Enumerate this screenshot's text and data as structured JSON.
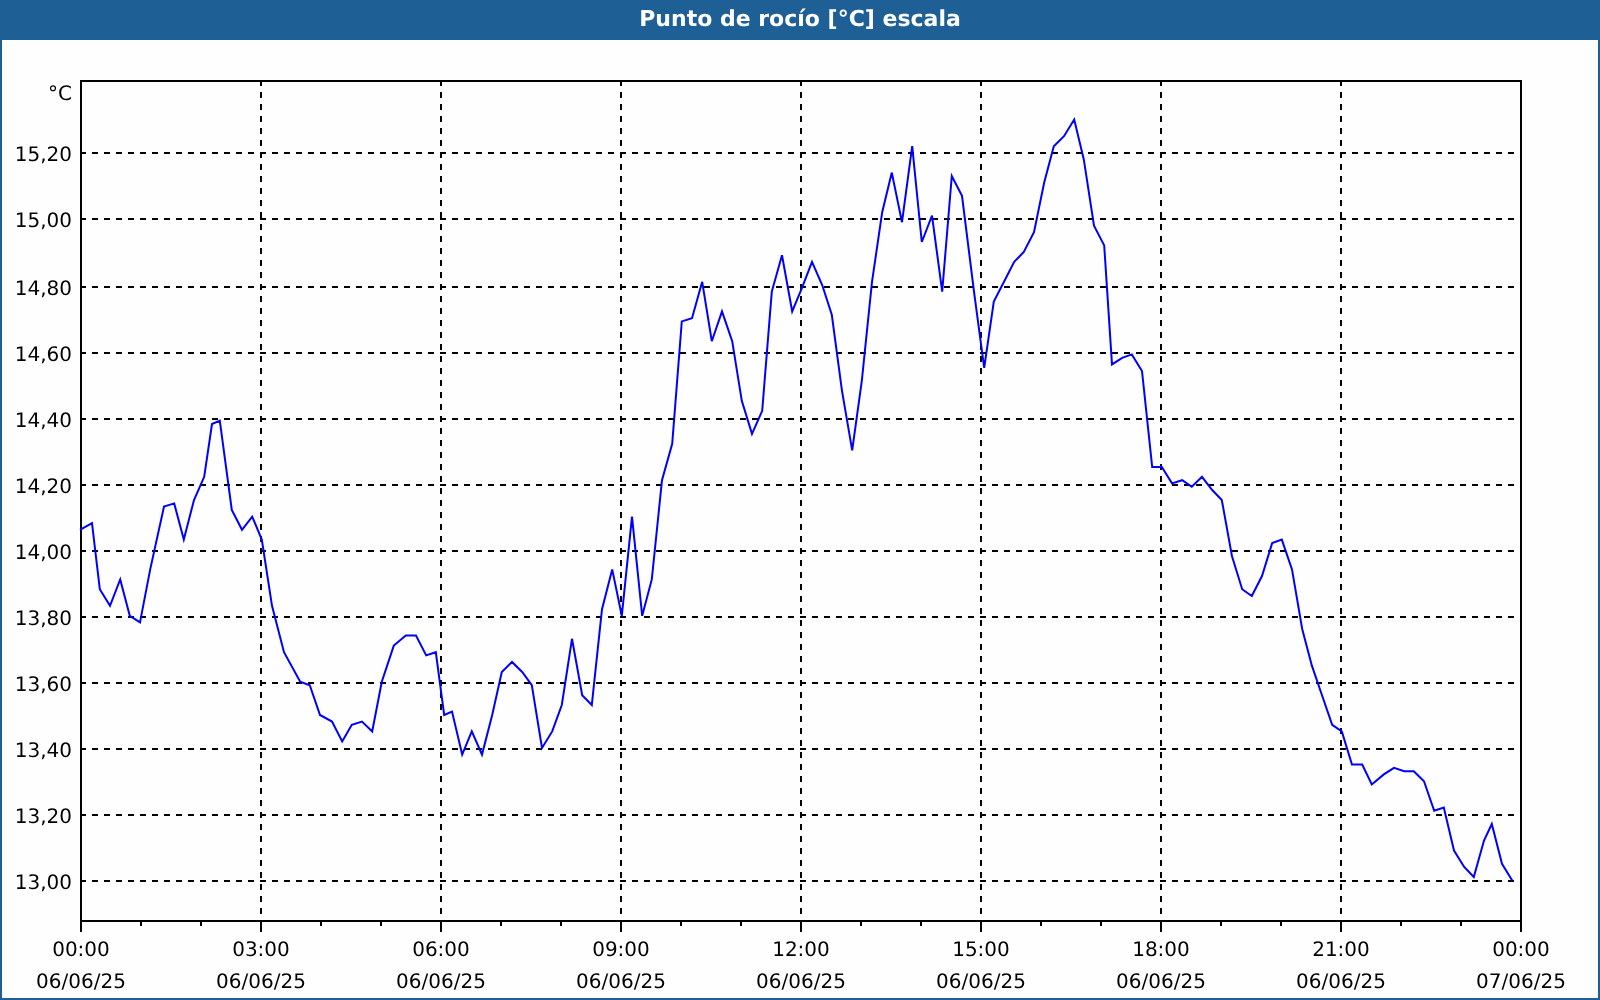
{
  "x_axis_dates": [
    "06/06/25",
    "06/06/25",
    "06/06/25",
    "06/06/25",
    "06/06/25",
    "06/06/25",
    "06/06/25",
    "06/06/25",
    "07/06/25"
  ],
  "chart_data": {
    "type": "line",
    "title": "Punto de rocío [°C] escala",
    "ylabel": "°C",
    "xlim": [
      0,
      24
    ],
    "ylim": [
      12.88,
      15.42
    ],
    "xticks": [
      {
        "value": 0,
        "label": "00:00"
      },
      {
        "value": 3,
        "label": "03:00"
      },
      {
        "value": 6,
        "label": "06:00"
      },
      {
        "value": 9,
        "label": "09:00"
      },
      {
        "value": 12,
        "label": "12:00"
      },
      {
        "value": 15,
        "label": "15:00"
      },
      {
        "value": 18,
        "label": "18:00"
      },
      {
        "value": 21,
        "label": "21:00"
      },
      {
        "value": 24,
        "label": "00:00"
      }
    ],
    "grid": true,
    "yticks": [
      {
        "value": 13,
        "label": "13,00"
      },
      {
        "value": 13.2,
        "label": "13,20"
      },
      {
        "value": 13.4,
        "label": "13,40"
      },
      {
        "value": 13.6,
        "label": "13,60"
      },
      {
        "value": 13.8,
        "label": "13,80"
      },
      {
        "value": 14,
        "label": "14,00"
      },
      {
        "value": 14.2,
        "label": "14,20"
      },
      {
        "value": 14.4,
        "label": "14,40"
      },
      {
        "value": 14.6,
        "label": "14,60"
      },
      {
        "value": 14.8,
        "label": "14,80"
      },
      {
        "value": 15,
        "label": "15,00"
      },
      {
        "value": 15.2,
        "label": "15,20"
      }
    ],
    "x": [
      0,
      0.2,
      0.33,
      0.5,
      0.67,
      0.83,
      1,
      1.17,
      1.4,
      1.57,
      1.73,
      1.9,
      2.07,
      2.2,
      2.33,
      2.53,
      2.7,
      2.87,
      3.03,
      3.2,
      3.4,
      3.67,
      3.83,
      4,
      4.2,
      4.37,
      4.53,
      4.7,
      4.87,
      5.03,
      5.23,
      5.43,
      5.6,
      5.77,
      5.93,
      6.07,
      6.2,
      6.37,
      6.53,
      6.7,
      6.87,
      7.03,
      7.2,
      7.37,
      7.53,
      7.7,
      7.87,
      8.03,
      8.2,
      8.37,
      8.53,
      8.7,
      8.87,
      9.03,
      9.2,
      9.37,
      9.53,
      9.7,
      9.87,
      10.03,
      10.2,
      10.37,
      10.53,
      10.7,
      10.87,
      11.03,
      11.2,
      11.37,
      11.53,
      11.7,
      11.87,
      12.03,
      12.2,
      12.37,
      12.53,
      12.7,
      12.87,
      13.03,
      13.2,
      13.37,
      13.53,
      13.7,
      13.87,
      14.03,
      14.2,
      14.37,
      14.53,
      14.7,
      14.9,
      15.07,
      15.23,
      15.4,
      15.57,
      15.73,
      15.9,
      16.07,
      16.23,
      16.4,
      16.57,
      16.73,
      16.9,
      17.07,
      17.2,
      17.37,
      17.53,
      17.7,
      17.87,
      18.03,
      18.2,
      18.37,
      18.53,
      18.7,
      18.87,
      19.03,
      19.2,
      19.37,
      19.53,
      19.7,
      19.87,
      20.03,
      20.2,
      20.37,
      20.53,
      20.7,
      20.87,
      21.03,
      21.2,
      21.37,
      21.53,
      21.73,
      21.9,
      22.07,
      22.23,
      22.4,
      22.57,
      22.73,
      22.9,
      23.07,
      23.23,
      23.4,
      23.53,
      23.7,
      23.87
    ],
    "series": [
      {
        "color": "#0000ff",
        "values": [
          14.06,
          14.08,
          13.88,
          13.83,
          13.91,
          13.8,
          13.78,
          13.94,
          14.13,
          14.14,
          14.03,
          14.15,
          14.22,
          14.38,
          14.39,
          14.12,
          14.06,
          14.1,
          14.03,
          13.83,
          13.69,
          13.6,
          13.59,
          13.5,
          13.48,
          13.42,
          13.47,
          13.48,
          13.45,
          13.6,
          13.71,
          13.74,
          13.74,
          13.68,
          13.69,
          13.5,
          13.51,
          13.38,
          13.45,
          13.38,
          13.5,
          13.63,
          13.66,
          13.63,
          13.59,
          13.4,
          13.45,
          13.53,
          13.73,
          13.56,
          13.53,
          13.82,
          13.94,
          13.8,
          14.1,
          13.8,
          13.91,
          14.21,
          14.32,
          14.69,
          14.7,
          14.81,
          14.63,
          14.72,
          14.63,
          14.45,
          14.35,
          14.42,
          14.78,
          14.89,
          14.72,
          14.79,
          14.87,
          14.8,
          14.71,
          14.48,
          14.3,
          14.51,
          14.81,
          15.02,
          15.14,
          14.99,
          15.22,
          14.93,
          15.01,
          14.78,
          15.13,
          15.07,
          14.78,
          14.55,
          14.75,
          14.81,
          14.87,
          14.9,
          14.96,
          15.11,
          15.22,
          15.25,
          15.3,
          15.18,
          14.98,
          14.92,
          14.56,
          14.58,
          14.59,
          14.54,
          14.25,
          14.25,
          14.2,
          14.21,
          14.19,
          14.22,
          14.18,
          14.15,
          13.98,
          13.88,
          13.86,
          13.92,
          14.02,
          14.03,
          13.94,
          13.76,
          13.65,
          13.56,
          13.47,
          13.45,
          13.35,
          13.35,
          13.29,
          13.32,
          13.34,
          13.33,
          13.33,
          13.3,
          13.21,
          13.22,
          13.09,
          13.04,
          13.01,
          13.12,
          13.17,
          13.05,
          13
        ]
      }
    ]
  }
}
